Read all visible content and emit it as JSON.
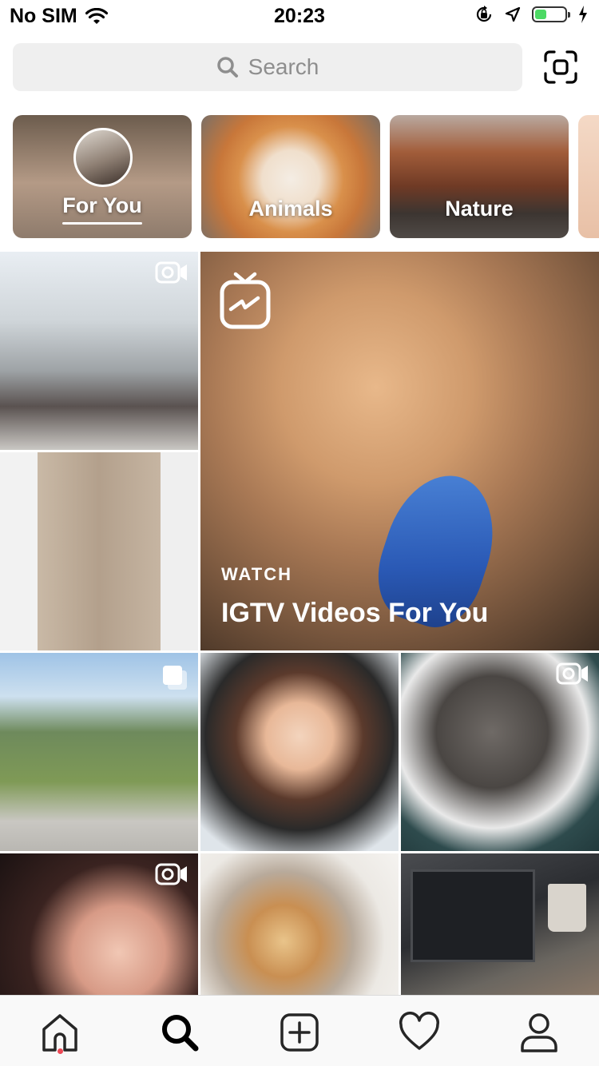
{
  "status_bar": {
    "carrier": "No SIM",
    "time": "20:23",
    "battery_level": 0.4
  },
  "search": {
    "placeholder": "Search"
  },
  "topics": [
    {
      "label": "For You",
      "selected": true
    },
    {
      "label": "Animals",
      "selected": false
    },
    {
      "label": "Nature",
      "selected": false
    }
  ],
  "igtv": {
    "kicker": "WATCH",
    "title": "IGTV Videos For You"
  },
  "grid_icons": {
    "video": "video-camera-icon",
    "multi": "multiple-photos-icon",
    "igtv": "igtv-icon"
  },
  "tab_bar": [
    {
      "name": "home",
      "icon": "home-icon",
      "active": false,
      "notification": true
    },
    {
      "name": "search",
      "icon": "search-icon",
      "active": true
    },
    {
      "name": "new-post",
      "icon": "plus-square-icon",
      "active": false
    },
    {
      "name": "activity",
      "icon": "heart-icon",
      "active": false
    },
    {
      "name": "profile",
      "icon": "person-icon",
      "active": false
    }
  ],
  "colors": {
    "notification": "#ed4956",
    "battery": "#4cd964",
    "search_bg": "#efefef"
  }
}
